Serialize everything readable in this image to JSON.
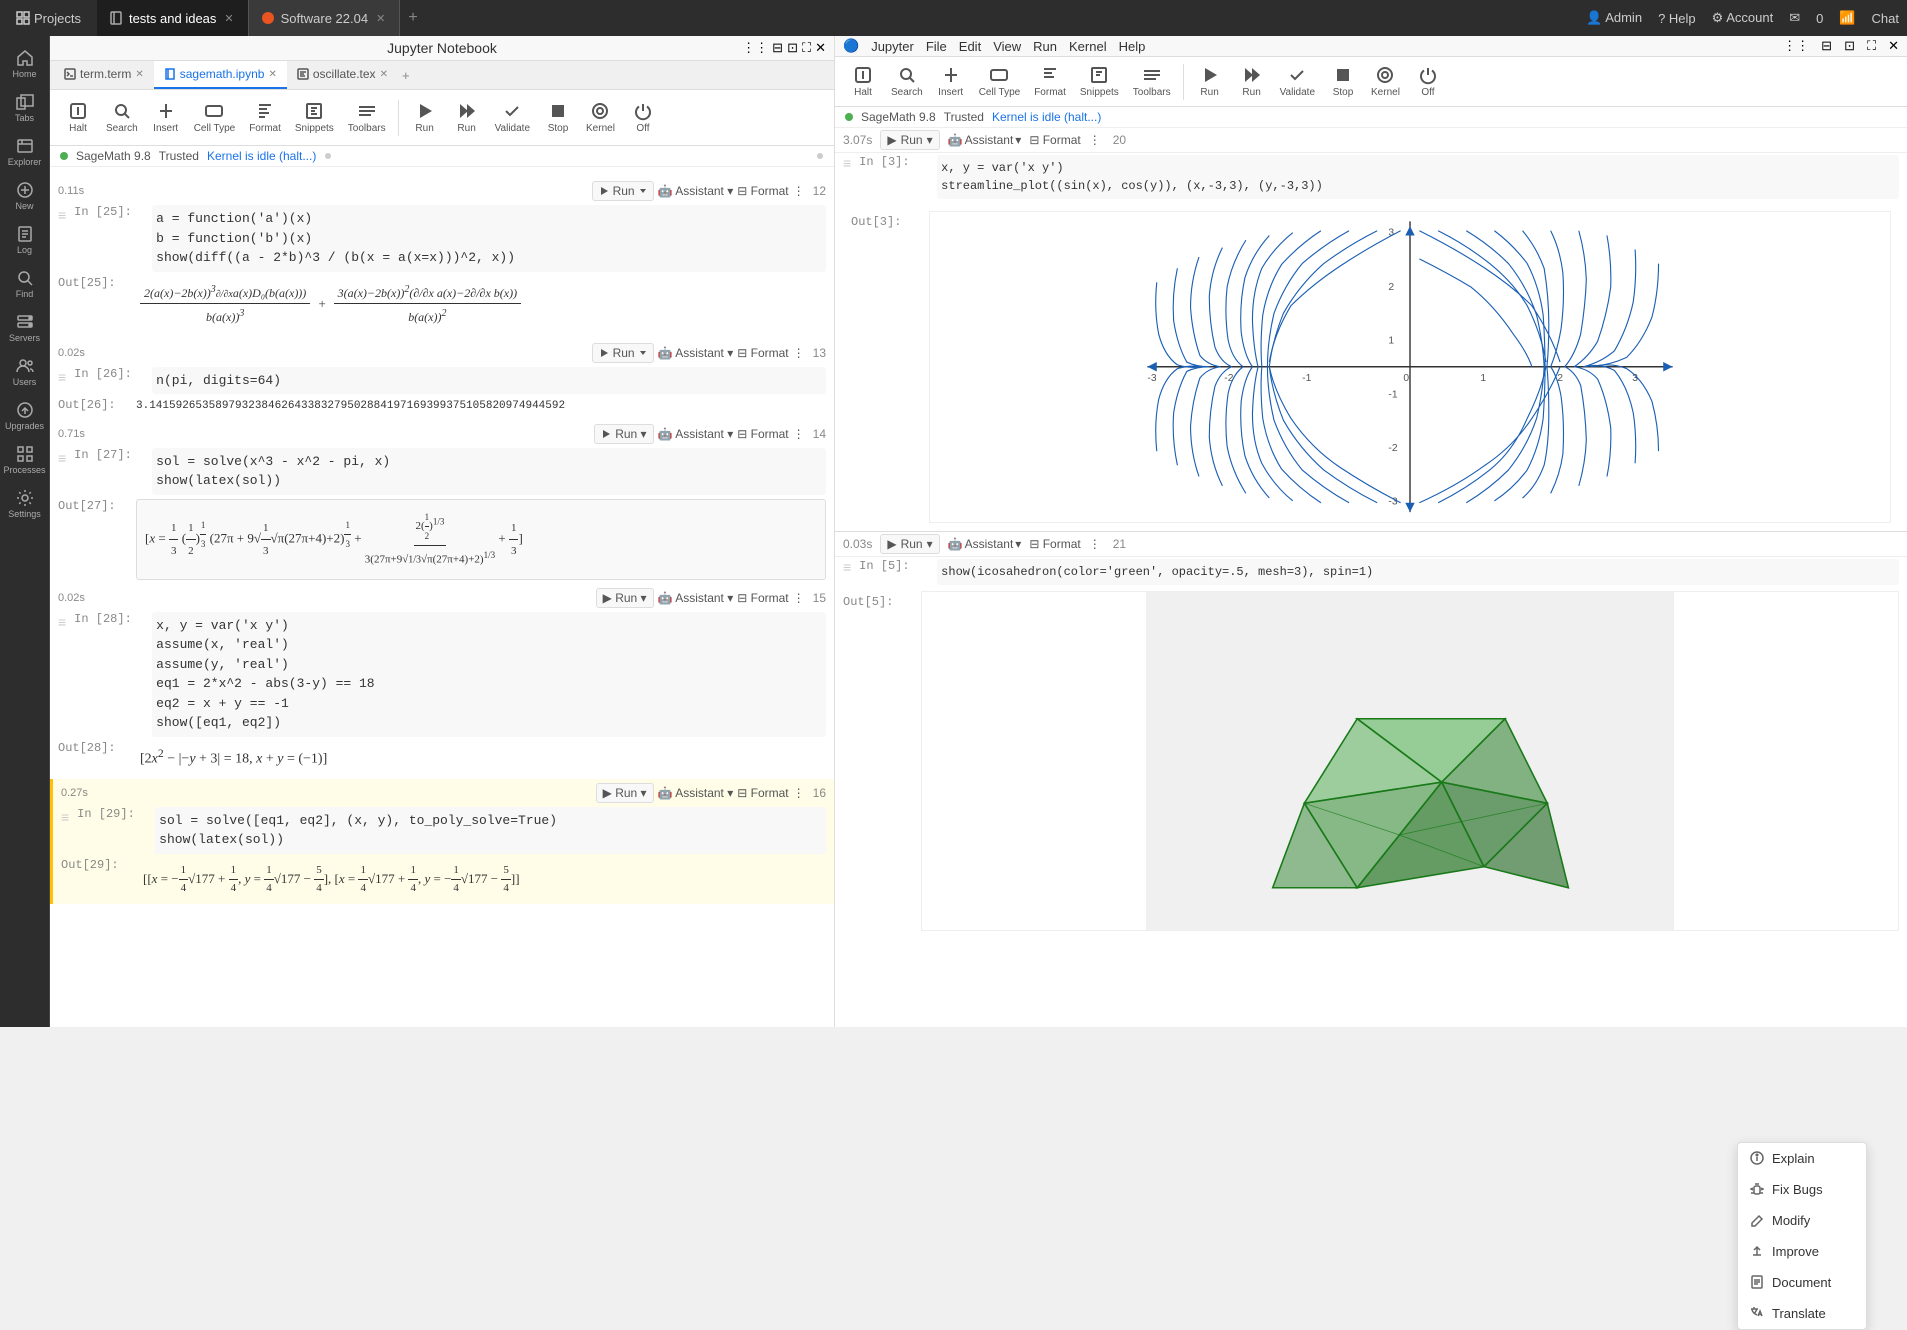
{
  "topbar": {
    "projects_label": "Projects",
    "tabs": [
      {
        "label": "tests and ideas",
        "active": true,
        "closable": true
      },
      {
        "label": "Software 22.04",
        "active": false,
        "closable": true
      }
    ],
    "add_tab": "+",
    "right_items": [
      "Admin",
      "Help",
      "Account",
      "0",
      "Chat"
    ]
  },
  "left_sidebar": {
    "items": [
      {
        "name": "home",
        "label": "Home",
        "icon": "home"
      },
      {
        "name": "tabs",
        "label": "Tabs",
        "icon": "tabs"
      },
      {
        "name": "explorer",
        "label": "Explorer",
        "icon": "explorer"
      },
      {
        "name": "new",
        "label": "New",
        "icon": "new"
      },
      {
        "name": "log",
        "label": "Log",
        "icon": "log"
      },
      {
        "name": "find",
        "label": "Find",
        "icon": "find"
      },
      {
        "name": "servers",
        "label": "Servers",
        "icon": "servers"
      },
      {
        "name": "users",
        "label": "Users",
        "icon": "users"
      },
      {
        "name": "upgrades",
        "label": "Upgrades",
        "icon": "upgrades"
      },
      {
        "name": "processes",
        "label": "Processes",
        "icon": "processes"
      },
      {
        "name": "settings",
        "label": "Settings",
        "icon": "settings"
      }
    ]
  },
  "left_notebook": {
    "header_title": "Jupyter Notebook",
    "file_tabs": [
      {
        "label": "term.term",
        "active": false
      },
      {
        "label": "sagemath.ipynb",
        "active": true
      },
      {
        "label": "oscillate.tex",
        "active": false
      }
    ],
    "toolbar": {
      "buttons": [
        {
          "name": "halt",
          "label": "Halt"
        },
        {
          "name": "search",
          "label": "Search"
        },
        {
          "name": "insert",
          "label": "Insert"
        },
        {
          "name": "cell-type",
          "label": "Cell Type"
        },
        {
          "name": "format-left",
          "label": "Format"
        },
        {
          "name": "snippets",
          "label": "Snippets"
        },
        {
          "name": "toolbars",
          "label": "Toolbars"
        },
        {
          "name": "run",
          "label": "Run"
        },
        {
          "name": "run2",
          "label": "Run"
        },
        {
          "name": "validate",
          "label": "Validate"
        },
        {
          "name": "stop",
          "label": "Stop"
        },
        {
          "name": "kernel",
          "label": "Kernel"
        },
        {
          "name": "off",
          "label": "Off"
        }
      ]
    },
    "kernel_info": {
      "engine": "SageMath 9.8",
      "trusted": "Trusted",
      "status": "Kernel is idle (halt...)"
    },
    "cells": [
      {
        "id": "cell-25",
        "label": "In [25]:",
        "time": "0.11s",
        "num": 12,
        "code": "a = function('a')(x)\nb = function('b')(x)\nshow(diff((a - 2*b)^3 / (b(x = a(x=x)))^2, x))",
        "output_label": "Out[25]:",
        "output_type": "math",
        "output": "math_expression_25"
      },
      {
        "id": "cell-26",
        "label": "In [26]:",
        "time": "0.02s",
        "num": 13,
        "code": "n(pi, digits=64)",
        "output_label": "Out[26]:",
        "output_type": "text",
        "output": "3.141592653589793238462643383279502884197169399375105820974944592"
      },
      {
        "id": "cell-27",
        "label": "In [27]:",
        "time": "0.71s",
        "num": 14,
        "code": "sol = solve(x^3 - x^2 - pi, x)\nshow(latex(sol))",
        "output_label": "Out[27]:",
        "output_type": "math",
        "output": "math_expression_27"
      },
      {
        "id": "cell-28",
        "label": "In [28]:",
        "time": "0.02s",
        "num": 15,
        "code": "x, y = var('x y')\nassume(x, 'real')\nassume(y, 'real')\neq1 = 2*x^2 - abs(3-y) == 18\neq2 = x + y == -1\nshow([eq1, eq2])",
        "output_label": "Out[28]:",
        "output_type": "math",
        "output": "math_expression_28"
      },
      {
        "id": "cell-29",
        "label": "In [29]:",
        "time": "0.27s",
        "num": 16,
        "code": "sol = solve([eq1, eq2], (x, y), to_poly_solve=True)\nshow(latex(sol))",
        "output_label": "Out[29]:",
        "output_type": "math",
        "output": "math_expression_29",
        "active": true
      }
    ]
  },
  "right_notebook": {
    "header_title": "Jupyter",
    "toolbar_right": {
      "buttons": [
        {
          "name": "halt-r",
          "label": "Halt"
        },
        {
          "name": "search-r",
          "label": "Search"
        },
        {
          "name": "insert-r",
          "label": "Insert"
        },
        {
          "name": "cell-type-r",
          "label": "Cell Type"
        },
        {
          "name": "format-r",
          "label": "Format"
        },
        {
          "name": "snippets-r",
          "label": "Snippets"
        },
        {
          "name": "toolbars-r",
          "label": "Toolbars"
        },
        {
          "name": "run-r",
          "label": "Run"
        },
        {
          "name": "run2-r",
          "label": "Run"
        },
        {
          "name": "validate-r",
          "label": "Validate"
        },
        {
          "name": "stop-r",
          "label": "Stop"
        },
        {
          "name": "kernel-r",
          "label": "Kernel"
        },
        {
          "name": "off-r",
          "label": "Off"
        }
      ]
    },
    "kernel_info": {
      "engine": "SageMath 9.8",
      "trusted": "Trusted",
      "status": "Kernel is idle (halt...)"
    },
    "top_cell": {
      "id": "cell-3",
      "label": "In [3]:",
      "time": "3.07s",
      "num": 20,
      "code": "x, y = var('x y')\nstreamline_plot((sin(x), cos(y)), (x,-3,3), (y,-3,3))",
      "output_label": "Out[3]:",
      "output_type": "chart",
      "chart": {
        "x_min": -3,
        "x_max": 3,
        "y_min": -3,
        "y_max": 3,
        "x_ticks": [
          -3,
          -2,
          -1,
          0,
          1,
          2,
          3
        ],
        "y_ticks": [
          -3,
          -2,
          -1,
          0,
          1,
          2,
          3
        ],
        "color": "#1a5fb4"
      }
    },
    "bottom_cell": {
      "id": "cell-5",
      "label": "In [5]:",
      "time": "0.03s",
      "num": 21,
      "code": "show(icosahedron(color='green', opacity=.5, mesh=3), spin=1)",
      "output_label": "Out[5]:",
      "output_type": "3d"
    },
    "assistant_dropdown": {
      "visible": true,
      "items": [
        {
          "name": "explain",
          "label": "Explain"
        },
        {
          "name": "fix-bugs",
          "label": "Fix Bugs"
        },
        {
          "name": "modify",
          "label": "Modify"
        },
        {
          "name": "improve",
          "label": "Improve"
        },
        {
          "name": "document",
          "label": "Document"
        },
        {
          "name": "translate",
          "label": "Translate"
        }
      ]
    },
    "second_bar": {
      "run_label": "Run",
      "assistant_label": "Assistant",
      "format_label": "Format",
      "num": "20"
    },
    "second_bar_bottom": {
      "run_label": "Run",
      "assistant_label": "Assistant",
      "format_label": "Format",
      "num": "21"
    }
  }
}
